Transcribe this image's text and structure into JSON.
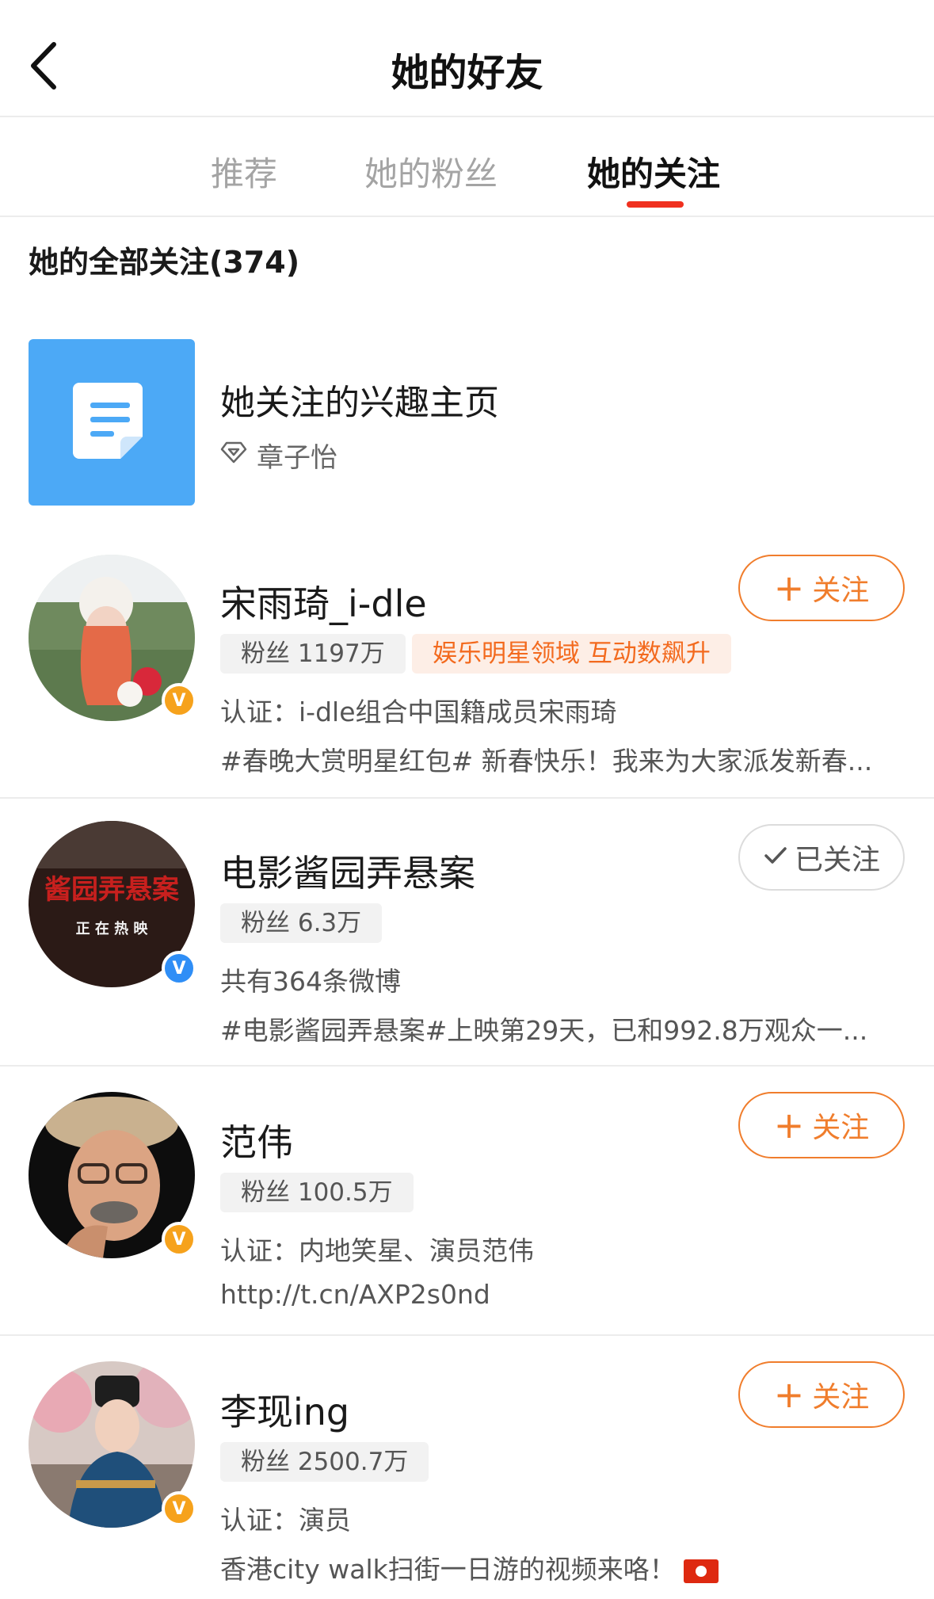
{
  "header": {
    "title": "她的好友"
  },
  "tabs": [
    {
      "label": "推荐"
    },
    {
      "label": "她的粉丝"
    },
    {
      "label": "她的关注"
    }
  ],
  "section": {
    "title": "她的全部关注(374)"
  },
  "interest": {
    "title": "她关注的兴趣主页",
    "owner": "章子怡"
  },
  "users": [
    {
      "name": "宋雨琦_i-dle",
      "fans": "粉丝 1197万",
      "hot_tag": "娱乐明星领域 互动数飙升",
      "line1": "认证：i-dle组合中国籍成员宋雨琦",
      "line2": "#春晚大赏明星红包# 新春快乐！我来为大家派发新春...",
      "button": "关注",
      "followed": false,
      "badge": "gold"
    },
    {
      "name": "电影酱园弄悬案",
      "fans": "粉丝 6.3万",
      "line1": "共有364条微博",
      "line2": "#电影酱园弄悬案#上映第29天，已和992.8万观众一...",
      "button": "已关注",
      "followed": true,
      "badge": "blue",
      "poster_title": "酱园弄悬案",
      "poster_sub": "正 在 热 映"
    },
    {
      "name": "范伟",
      "fans": "粉丝 100.5万",
      "line1": "认证：内地笑星、演员范伟",
      "line2": "http://t.cn/AXP2s0nd",
      "button": "关注",
      "followed": false,
      "badge": "gold"
    },
    {
      "name": "李现ing",
      "fans": "粉丝 2500.7万",
      "line1": "认证：演员",
      "line2": "香港city walk扫街一日游的视频来咯！",
      "button": "关注",
      "followed": false,
      "badge": "gold"
    }
  ],
  "colors": {
    "accent": "#f07d2c",
    "tab_indicator": "#f0301f",
    "interest_bg": "#4ca9f6",
    "badge_gold": "#f6a21c",
    "badge_blue": "#2f8ef6"
  }
}
